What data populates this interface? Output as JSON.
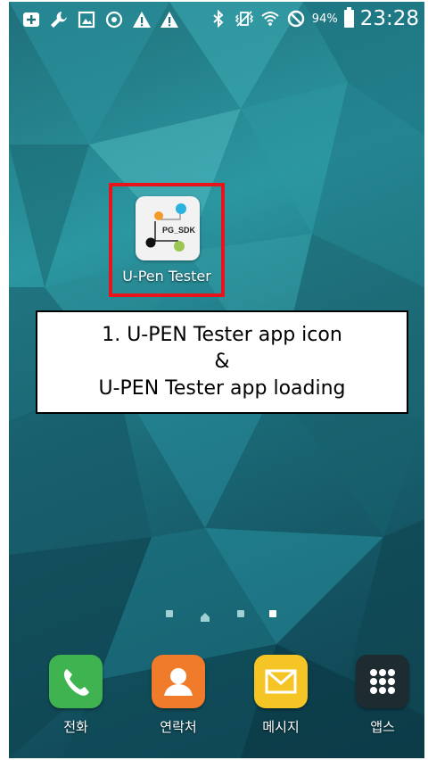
{
  "status_bar": {
    "left_icons": [
      "add-notification-icon",
      "wrench-icon",
      "image-icon",
      "sync-icon",
      "warning-icon",
      "warning-icon-2"
    ],
    "right_icons": [
      "bluetooth-icon",
      "vibrate-icon",
      "wifi-icon",
      "block-icon",
      "battery-icon"
    ],
    "battery_percent": "94%",
    "time": "23:28"
  },
  "app": {
    "name": "U-Pen Tester",
    "icon_text": "PG_SDK",
    "highlight_color": "#e8141c"
  },
  "annotation": {
    "line1": "1. U-PEN Tester app icon",
    "line2": "&",
    "line3": "U-PEN Tester app loading"
  },
  "page_indicator": {
    "pages": 4,
    "home_index": 1,
    "active_index": 3
  },
  "dock": [
    {
      "label": "전화",
      "icon": "phone-icon",
      "color": "#3fb34f"
    },
    {
      "label": "연락처",
      "icon": "contacts-icon",
      "color": "#f07b2a"
    },
    {
      "label": "메시지",
      "icon": "messages-icon",
      "color": "#f5c526"
    },
    {
      "label": "앱스",
      "icon": "apps-icon",
      "color": "#1e2b30"
    }
  ]
}
